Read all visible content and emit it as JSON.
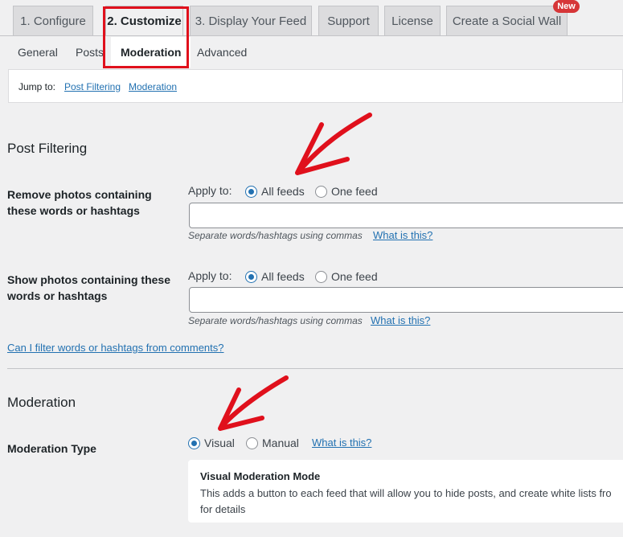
{
  "tabs": [
    {
      "label": "1. Configure"
    },
    {
      "label": "2. Customize"
    },
    {
      "label": "3. Display Your Feed"
    },
    {
      "label": "Support"
    },
    {
      "label": "License"
    },
    {
      "label": "Create a Social Wall"
    }
  ],
  "new_badge": "New",
  "subtabs": [
    {
      "label": "General"
    },
    {
      "label": "Posts"
    },
    {
      "label": "Moderation"
    },
    {
      "label": "Advanced"
    }
  ],
  "jump": {
    "label": "Jump to:",
    "links": [
      "Post Filtering",
      "Moderation"
    ]
  },
  "post_filtering": {
    "heading": "Post Filtering",
    "remove": {
      "label": "Remove photos containing these words or hashtags",
      "apply_to": "Apply to:",
      "options": [
        "All feeds",
        "One feed"
      ],
      "selected": "All feeds",
      "value": "",
      "hint": "Separate words/hashtags using commas",
      "help": "What is this?"
    },
    "show": {
      "label": "Show photos containing these words or hashtags",
      "apply_to": "Apply to:",
      "options": [
        "All feeds",
        "One feed"
      ],
      "selected": "All feeds",
      "value": "",
      "hint": "Separate words/hashtags using commas",
      "help": "What is this?"
    },
    "comments_link": "Can I filter words or hashtags from comments?"
  },
  "moderation": {
    "heading": "Moderation",
    "type_label": "Moderation Type",
    "options": [
      "Visual",
      "Manual"
    ],
    "selected": "Visual",
    "help": "What is this?",
    "info_title": "Visual Moderation Mode",
    "info_text": "This adds a button to each feed that will allow you to hide posts, and create white lists fro for details"
  },
  "colors": {
    "accent": "#2271b1",
    "highlight": "#e0101c",
    "badge": "#d63638"
  }
}
